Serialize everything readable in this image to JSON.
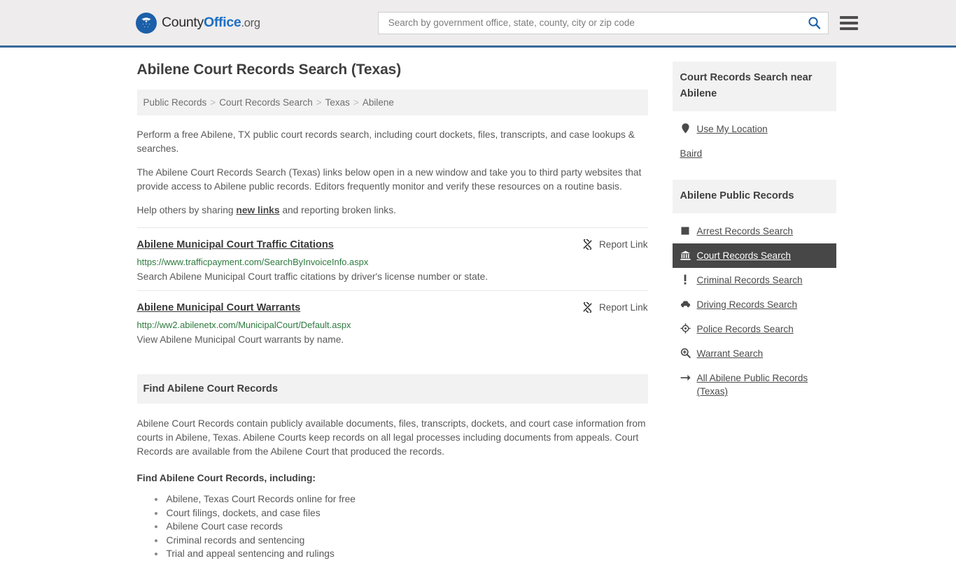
{
  "header": {
    "logo": {
      "text_county": "County",
      "text_office": "Office",
      "text_org": ".org",
      "mark_icon": "eagle-stars-emblem-icon"
    },
    "search": {
      "placeholder": "Search by government office, state, county, city or zip code",
      "value": "",
      "button_icon": "search-icon"
    },
    "menu_icon": "hamburger-menu-icon",
    "accent_color": "#36699c",
    "background_color": "#eeecec"
  },
  "main": {
    "page_title": "Abilene Court Records Search (Texas)",
    "breadcrumb": [
      {
        "label": "Public Records"
      },
      {
        "label": "Court Records Search"
      },
      {
        "label": "Texas"
      },
      {
        "label": "Abilene"
      }
    ],
    "breadcrumb_separator": ">",
    "intro": {
      "p1": "Perform a free Abilene, TX public court records search, including court dockets, files, transcripts, and case lookups & searches.",
      "p2": "The Abilene Court Records Search (Texas) links below open in a new window and take you to third party websites that provide access to Abilene public records. Editors frequently monitor and verify these resources on a routine basis.",
      "p3_before": "Help others by sharing ",
      "p3_link": "new links",
      "p3_after": " and reporting broken links."
    },
    "results": [
      {
        "title": "Abilene Municipal Court Traffic Citations",
        "url": "https://www.trafficpayment.com/SearchByInvoiceInfo.aspx",
        "description": "Search Abilene Municipal Court traffic citations by driver's license number or state.",
        "report_label": "Report Link",
        "report_icon": "broken-link-icon"
      },
      {
        "title": "Abilene Municipal Court Warrants",
        "url": "http://ww2.abilenetx.com/MunicipalCourt/Default.aspx",
        "description": "View Abilene Municipal Court warrants by name.",
        "report_label": "Report Link",
        "report_icon": "broken-link-icon"
      }
    ],
    "section": {
      "heading": "Find Abilene Court Records",
      "paragraph": "Abilene Court Records contain publicly available documents, files, transcripts, dockets, and court case information from courts in Abilene, Texas. Abilene Courts keep records on all legal processes including documents from appeals. Court Records are available from the Abilene Court that produced the records.",
      "subheading": "Find Abilene Court Records, including:",
      "bullets": [
        "Abilene, Texas Court Records online for free",
        "Court filings, dockets, and case files",
        "Abilene Court case records",
        "Criminal records and sentencing",
        "Trial and appeal sentencing and rulings"
      ]
    }
  },
  "sidebar": {
    "nearby": {
      "heading": "Court Records Search near Abilene",
      "items": [
        {
          "label": "Use My Location",
          "icon": "map-pin-icon",
          "has_icon": true,
          "active": false
        },
        {
          "label": "Baird",
          "icon": "",
          "has_icon": false,
          "active": false
        }
      ]
    },
    "public_records": {
      "heading": "Abilene Public Records",
      "items": [
        {
          "label": "Arrest Records Search",
          "icon": "square-icon",
          "has_icon": true,
          "active": false
        },
        {
          "label": "Court Records Search",
          "icon": "courthouse-icon",
          "has_icon": true,
          "active": true
        },
        {
          "label": "Criminal Records Search",
          "icon": "exclamation-icon",
          "has_icon": true,
          "active": false
        },
        {
          "label": "Driving Records Search",
          "icon": "car-icon",
          "has_icon": true,
          "active": false
        },
        {
          "label": "Police Records Search",
          "icon": "police-badge-icon",
          "has_icon": true,
          "active": false
        },
        {
          "label": "Warrant Search",
          "icon": "magnifier-plus-icon",
          "has_icon": true,
          "active": false
        },
        {
          "label": "All Abilene Public Records (Texas)",
          "icon": "arrow-right-icon",
          "has_icon": true,
          "active": false
        }
      ],
      "active_background_color": "#474747"
    }
  }
}
